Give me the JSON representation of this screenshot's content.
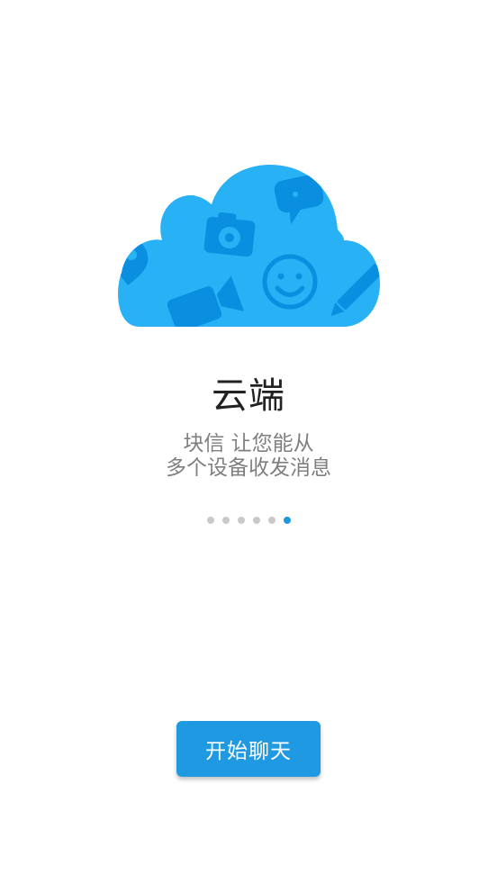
{
  "onboarding": {
    "title": "云端",
    "subtitle_line1": "块信 让您能从",
    "subtitle_line2": "多个设备收发消息",
    "page_indicator": {
      "total": 6,
      "current": 6
    },
    "start_button_label": "开始聊天"
  },
  "colors": {
    "cloud": "#29b1f5",
    "cloud_icons": "#0a8fe0",
    "accent": "#1f9ae2",
    "dot_inactive": "#c9c9c9",
    "dot_active": "#2196e0"
  },
  "illustration_icons": [
    "chat-bubble-icon",
    "camera-icon",
    "smiley-icon",
    "video-camera-icon",
    "pencil-icon",
    "location-pin-icon"
  ]
}
